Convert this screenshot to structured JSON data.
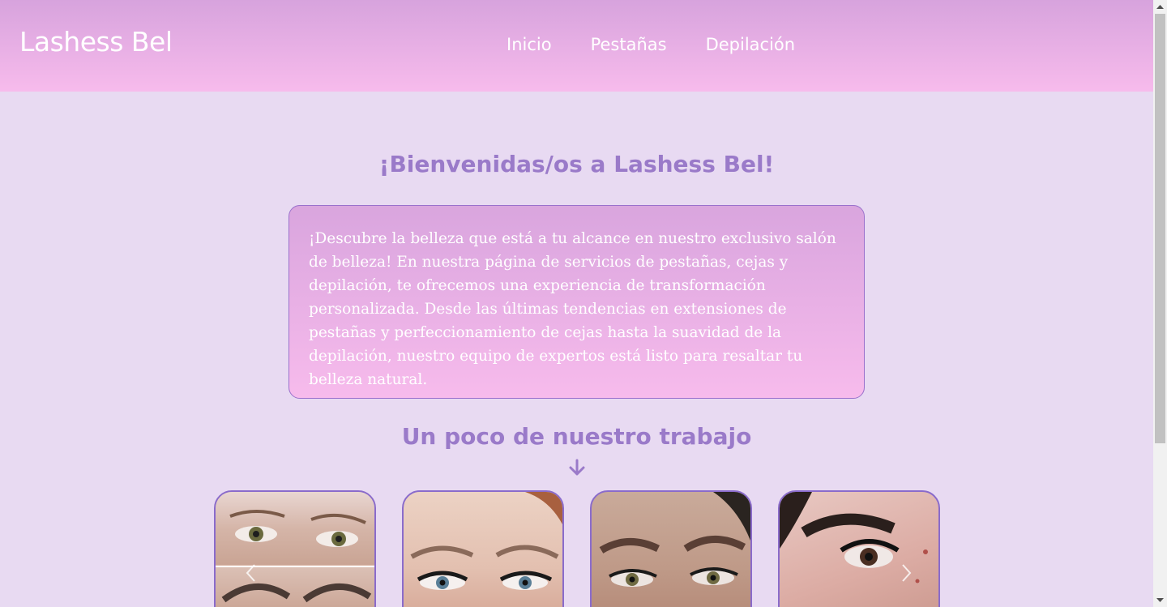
{
  "header": {
    "logo": "Lashess Bel",
    "nav": [
      {
        "label": "Inicio"
      },
      {
        "label": "Pestañas"
      },
      {
        "label": "Depilación"
      }
    ]
  },
  "main": {
    "welcome_title": "¡Bienvenidas/os a Lashess Bel!",
    "intro_text": "¡Descubre la belleza que está a tu alcance en nuestro exclusivo salón de belleza! En nuestra página de servicios de pestañas, cejas y depilación, te ofrecemos una experiencia de transformación personalizada. Desde las últimas tendencias en extensiones de pestañas y perfeccionamiento de cejas hasta la suavidad de la depilación, nuestro equipo de expertos está listo para resaltar tu belleza natural.",
    "gallery_title": "Un poco de nuestro trabajo",
    "gallery_arrow_icon": "arrow-down-icon",
    "gallery": [
      {
        "name": "gallery-photo-1"
      },
      {
        "name": "gallery-photo-2"
      },
      {
        "name": "gallery-photo-3"
      },
      {
        "name": "gallery-photo-4"
      }
    ]
  },
  "colors": {
    "header_top": "#d7a3dd",
    "header_bottom": "#f7bbec",
    "page_bg": "#e8daf2",
    "accent": "#9a7ac9",
    "border": "#8a6bcb"
  }
}
